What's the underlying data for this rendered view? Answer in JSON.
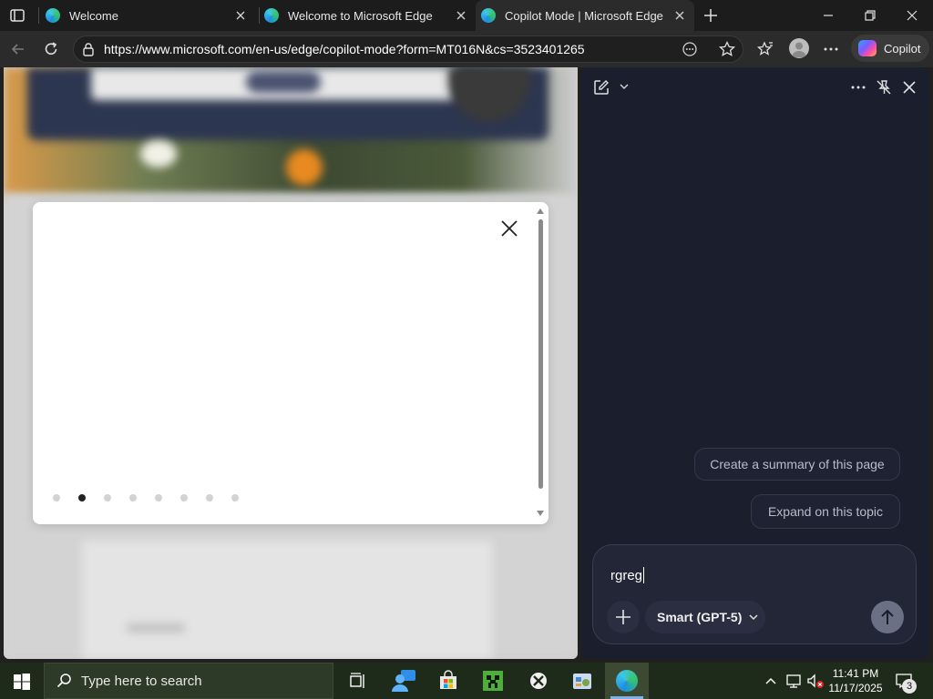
{
  "browser": {
    "tabs": [
      {
        "title": "Welcome",
        "active": false
      },
      {
        "title": "Welcome to Microsoft Edge",
        "active": false
      },
      {
        "title": "Copilot Mode | Microsoft Edge",
        "active": true
      }
    ],
    "url": "https://www.microsoft.com/en-us/edge/copilot-mode?form=MT016N&cs=3523401265",
    "copilot_button_label": "Copilot"
  },
  "modal": {
    "carousel_dots": 8,
    "active_dot_index": 1
  },
  "copilot_pane": {
    "suggestions": [
      "Create a summary of this page",
      "Expand on this topic"
    ],
    "input_value": "rgreg",
    "model_label": "Smart (GPT-5)"
  },
  "taskbar": {
    "search_placeholder": "Type here to search",
    "time": "11:41 PM",
    "date": "11/17/2025",
    "notification_count": "3"
  },
  "colors": {
    "pane_bg": "#1b1e2c",
    "taskbar_bg": "#1f2b1a",
    "send_button": "#6b7085"
  }
}
